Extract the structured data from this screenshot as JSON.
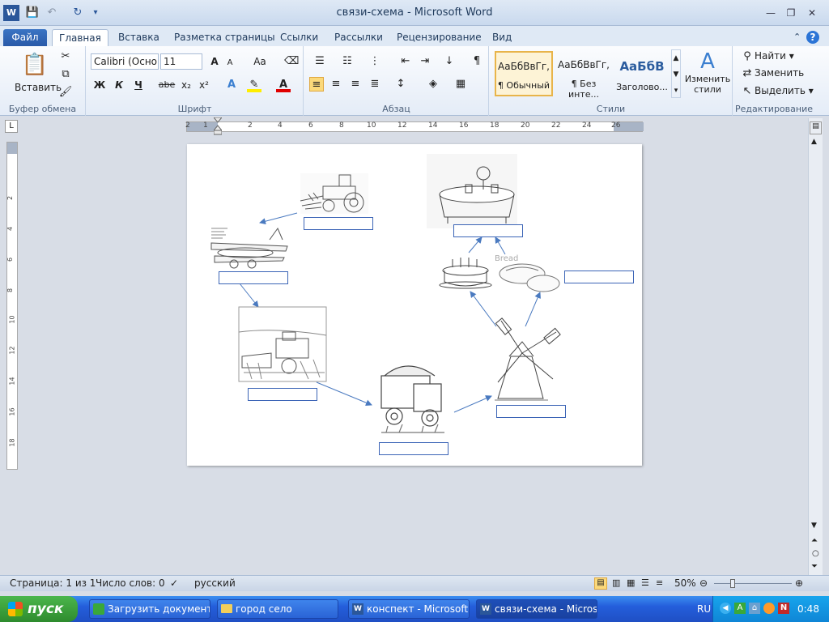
{
  "window": {
    "title": "связи-схема  -  Microsoft Word"
  },
  "tabs": [
    "Файл",
    "Главная",
    "Вставка",
    "Разметка страницы",
    "Ссылки",
    "Рассылки",
    "Рецензирование",
    "Вид"
  ],
  "ribbon": {
    "clipboard": {
      "paste": "Вставить",
      "label": "Буфер обмена"
    },
    "font": {
      "name": "Calibri (Осно",
      "size": "11",
      "label": "Шрифт",
      "bold": "Ж",
      "italic": "К",
      "underline": "Ч",
      "strike": "abe",
      "sub": "x₂",
      "sup": "x²",
      "grow": "A",
      "shrink": "A",
      "case": "Aa"
    },
    "paragraph": {
      "label": "Абзац"
    },
    "styles": {
      "label": "Стили",
      "items": [
        {
          "sample": "АаБбВвГг,",
          "name": "¶ Обычный"
        },
        {
          "sample": "АаБбВвГг,",
          "name": "¶ Без инте..."
        },
        {
          "sample": "АаБбВ",
          "name": "Заголово..."
        }
      ],
      "change": "Изменить стили"
    },
    "editing": {
      "label": "Редактирование",
      "find": "Найти",
      "replace": "Заменить",
      "select": "Выделить"
    }
  },
  "ruler": {
    "labels": [
      "2",
      "1",
      "2",
      "4",
      "6",
      "8",
      "10",
      "12",
      "14",
      "16",
      "18",
      "20",
      "22",
      "24",
      "26"
    ],
    "vlabels": [
      "2",
      "4",
      "6",
      "8",
      "10",
      "12",
      "14",
      "16",
      "18"
    ]
  },
  "document": {
    "images": [
      "tractor-image",
      "airplane-image",
      "harvester-image",
      "truck-image",
      "windmill-image",
      "cake-image",
      "bread-image",
      "table-image"
    ],
    "bread_text": "Bread"
  },
  "status": {
    "page": "Страница: 1 из 1",
    "words": "Число слов: 0",
    "lang": "русский",
    "zoom": "50%"
  },
  "taskbar": {
    "start": "пуск",
    "tasks": [
      "Загрузить документ...",
      "город село",
      "конспект - Microsoft ...",
      "связи-схема - Micros..."
    ],
    "lang": "RU",
    "time": "0:48"
  }
}
